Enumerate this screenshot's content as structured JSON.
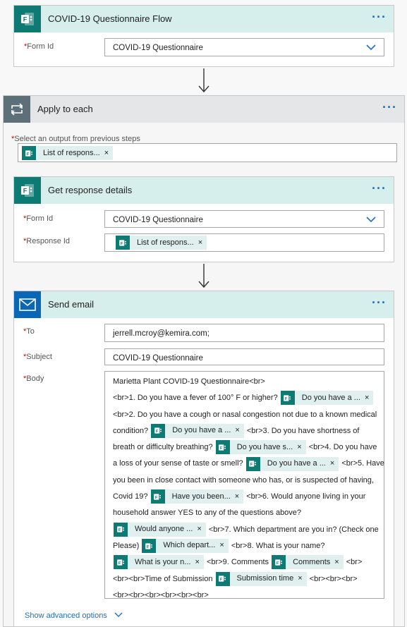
{
  "trigger": {
    "title": "COVID-19 Questionnaire Flow",
    "more": "···",
    "form_id_label": "Form Id",
    "form_id_value": "COVID-19 Questionnaire"
  },
  "apply_each": {
    "title": "Apply to each",
    "more": "···",
    "select_label": "Select an output from previous steps",
    "select_token": "List of respons...",
    "token_close": "×"
  },
  "get_response": {
    "title": "Get response details",
    "more": "···",
    "form_id_label": "Form Id",
    "form_id_value": "COVID-19 Questionnaire",
    "response_id_label": "Response Id",
    "response_id_token": "List of respons..."
  },
  "send_email": {
    "title": "Send email",
    "more": "···",
    "to_label": "To",
    "to_value": "jerrell.mcroy@kemira.com;",
    "subject_label": "Subject",
    "subject_value": "COVID-19 Questionnaire",
    "body_label": "Body",
    "body_lines": [
      [
        {
          "t": "text",
          "v": "Marietta Plant COVID-19 Questionnaire<br>"
        }
      ],
      [
        {
          "t": "text",
          "v": "<br>1. Do you have a fever of 100° F or higher? "
        },
        {
          "t": "token",
          "v": "Do you have a ..."
        }
      ],
      [
        {
          "t": "text",
          "v": "<br>2.  Do you have a cough or nasal congestion not due to a known medical"
        }
      ],
      [
        {
          "t": "text",
          "v": "condition? "
        },
        {
          "t": "token",
          "v": "Do you have a ..."
        },
        {
          "t": "text",
          "v": " <br>3.  Do you have shortness of"
        }
      ],
      [
        {
          "t": "text",
          "v": "breath or difficulty breathing? "
        },
        {
          "t": "token",
          "v": "Do you have s..."
        },
        {
          "t": "text",
          "v": " <br>4. Do you have"
        }
      ],
      [
        {
          "t": "text",
          "v": "a loss of your sense of taste or smell? "
        },
        {
          "t": "token",
          "v": "Do you have a ..."
        },
        {
          "t": "text",
          "v": " <br>5. Have"
        }
      ],
      [
        {
          "t": "text",
          "v": "you been in close contact with someone who has, or is suspected of having,"
        }
      ],
      [
        {
          "t": "text",
          "v": "Covid 19? "
        },
        {
          "t": "token",
          "v": "Have you been..."
        },
        {
          "t": "text",
          "v": " <br>6. Would anyone living in your"
        }
      ],
      [
        {
          "t": "text",
          "v": "household answer YES to any of the questions above?"
        }
      ],
      [
        {
          "t": "token",
          "v": "Would anyone ..."
        },
        {
          "t": "text",
          "v": " <br>7. Which department are you in? (Check one"
        }
      ],
      [
        {
          "t": "text",
          "v": "Please) "
        },
        {
          "t": "token",
          "v": "Which depart..."
        },
        {
          "t": "text",
          "v": " <br>8. What is your name?"
        }
      ],
      [
        {
          "t": "token",
          "v": "What is your n..."
        },
        {
          "t": "text",
          "v": " <br>9. Comments "
        },
        {
          "t": "token",
          "v": "Comments"
        },
        {
          "t": "text",
          "v": " <br>"
        }
      ],
      [
        {
          "t": "text",
          "v": "<br><br>Time of Submission "
        },
        {
          "t": "token",
          "v": "Submission time"
        },
        {
          "t": "text",
          "v": " <br><br><br>"
        }
      ],
      [
        {
          "t": "text",
          "v": "<br><br><br><br><br><br>"
        }
      ]
    ],
    "show_advanced": "Show advanced options"
  },
  "icons": {
    "forms": "forms-icon",
    "loop": "loop-icon",
    "mail": "mail-icon",
    "chevron": "chevron-down-icon",
    "more": "ellipsis-icon",
    "arrow": "arrow-down-icon"
  },
  "colors": {
    "forms_teal": "#0e7a74",
    "header_teal": "#d6eeec",
    "header_grey": "#e4e6e8",
    "loop_slate": "#5d6f79",
    "outlook_blue": "#0a66b7",
    "link_blue": "#1f6fbf",
    "token_bg": "#dff0ee"
  }
}
